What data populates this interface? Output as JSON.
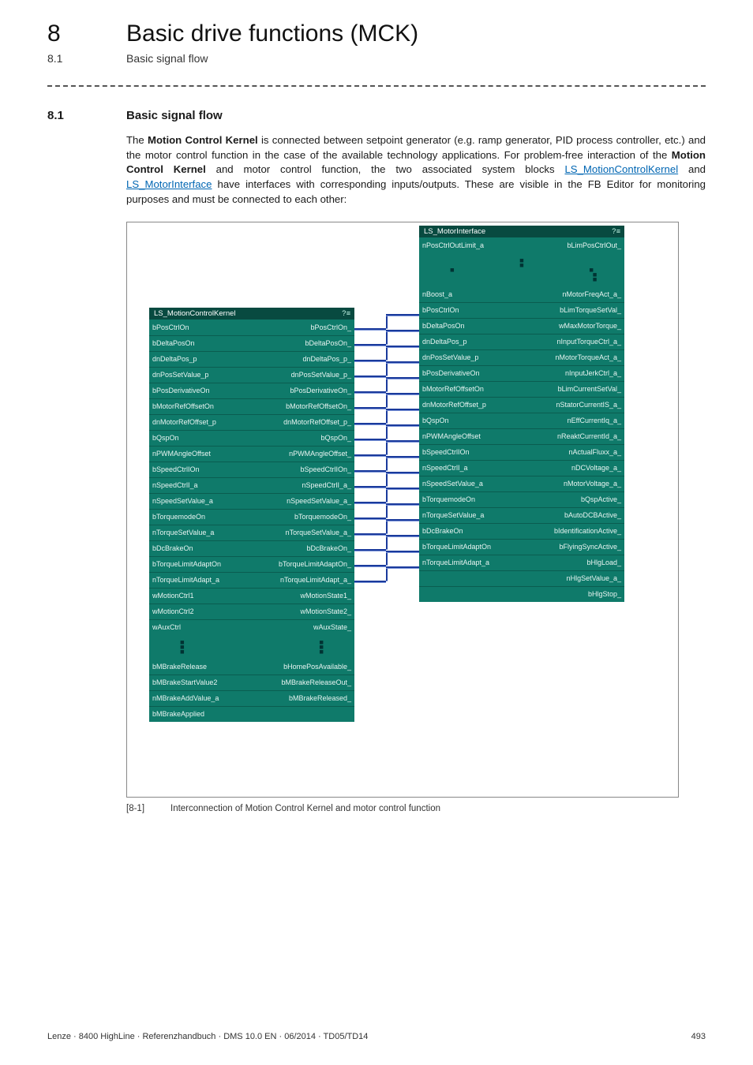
{
  "header": {
    "chapter_number": "8",
    "chapter_title": "Basic drive functions (MCK)",
    "sub_number": "8.1",
    "sub_title": "Basic signal flow"
  },
  "section": {
    "number": "8.1",
    "title": "Basic signal flow"
  },
  "paragraph": {
    "p1a": "The ",
    "p1b": "Motion Control Kernel",
    "p1c": " is connected between setpoint generator (e.g. ramp generator, PID process controller, etc.) and the motor control function in the case of the available technology applications. For problem-free interaction of the ",
    "p1d": "Motion Control Kernel",
    "p1e": " and motor control function, the two associated system blocks ",
    "link1": "LS_MotionControlKernel",
    "p1f": " and ",
    "link2": "LS_MotorInterface",
    "p1g": " have interfaces with corresponding inputs/outputs. These are visible in the FB Editor for monitoring purposes and must be connected to each other:"
  },
  "diagram": {
    "kernel": {
      "title": "LS_MotionControlKernel",
      "rows": [
        {
          "l": "bPosCtrlOn",
          "r": "bPosCtrlOn_"
        },
        {
          "l": "bDeltaPosOn",
          "r": "bDeltaPosOn_"
        },
        {
          "l": "dnDeltaPos_p",
          "r": "dnDeltaPos_p_"
        },
        {
          "l": "dnPosSetValue_p",
          "r": "dnPosSetValue_p_"
        },
        {
          "l": "bPosDerivativeOn",
          "r": "bPosDerivativeOn_"
        },
        {
          "l": "bMotorRefOffsetOn",
          "r": "bMotorRefOffsetOn_"
        },
        {
          "l": "dnMotorRefOffset_p",
          "r": "dnMotorRefOffset_p_"
        },
        {
          "l": "bQspOn",
          "r": "bQspOn_"
        },
        {
          "l": "nPWMAngleOffset",
          "r": "nPWMAngleOffset_"
        },
        {
          "l": "bSpeedCtrlIOn",
          "r": "bSpeedCtrlIOn_"
        },
        {
          "l": "nSpeedCtrlI_a",
          "r": "nSpeedCtrlI_a_"
        },
        {
          "l": "nSpeedSetValue_a",
          "r": "nSpeedSetValue_a_"
        },
        {
          "l": "bTorquemodeOn",
          "r": "bTorquemodeOn_"
        },
        {
          "l": "nTorqueSetValue_a",
          "r": "nTorqueSetValue_a_"
        },
        {
          "l": "bDcBrakeOn",
          "r": "bDcBrakeOn_"
        },
        {
          "l": "bTorqueLimitAdaptOn",
          "r": "bTorqueLimitAdaptOn_"
        },
        {
          "l": "nTorqueLimitAdapt_a",
          "r": "nTorqueLimitAdapt_a_"
        },
        {
          "l": "wMotionCtrl1",
          "r": "wMotionState1_"
        },
        {
          "l": "wMotionCtrl2",
          "r": "wMotionState2_"
        },
        {
          "l": "wAuxCtrl",
          "r": "wAuxState_"
        }
      ],
      "tail": [
        {
          "l": "bMBrakeRelease",
          "r": "bHomePosAvailable_"
        },
        {
          "l": "bMBrakeStartValue2",
          "r": "bMBrakeReleaseOut_"
        },
        {
          "l": "nMBrakeAddValue_a",
          "r": "bMBrakeReleased_"
        },
        {
          "l": "bMBrakeApplied",
          "r": ""
        }
      ]
    },
    "motor": {
      "title": "LS_MotorInterface",
      "head": [
        {
          "l": "nPosCtrlOutLimit_a",
          "r": "bLimPosCtrlOut_"
        }
      ],
      "rows": [
        {
          "l": "nBoost_a",
          "r": "nMotorFreqAct_a_"
        },
        {
          "l": "bPosCtrlOn",
          "r": "bLimTorqueSetVal_"
        },
        {
          "l": "bDeltaPosOn",
          "r": "wMaxMotorTorque_"
        },
        {
          "l": "dnDeltaPos_p",
          "r": "nInputTorqueCtrl_a_"
        },
        {
          "l": "dnPosSetValue_p",
          "r": "nMotorTorqueAct_a_"
        },
        {
          "l": "bPosDerivativeOn",
          "r": "nInputJerkCtrl_a_"
        },
        {
          "l": "bMotorRefOffsetOn",
          "r": "bLimCurrentSetVal_"
        },
        {
          "l": "dnMotorRefOffset_p",
          "r": "nStatorCurrentIS_a_"
        },
        {
          "l": "bQspOn",
          "r": "nEffCurrentIq_a_"
        },
        {
          "l": "nPWMAngleOffset",
          "r": "nReaktCurrentId_a_"
        },
        {
          "l": "bSpeedCtrlIOn",
          "r": "nActualFluxx_a_"
        },
        {
          "l": "nSpeedCtrlI_a",
          "r": "nDCVoltage_a_"
        },
        {
          "l": "nSpeedSetValue_a",
          "r": "nMotorVoltage_a_"
        },
        {
          "l": "bTorquemodeOn",
          "r": "bQspActive_"
        },
        {
          "l": "nTorqueSetValue_a",
          "r": "bAutoDCBActive_"
        },
        {
          "l": "bDcBrakeOn",
          "r": "bIdentificationActive_"
        },
        {
          "l": "bTorqueLimitAdaptOn",
          "r": "bFlyingSyncActive_"
        },
        {
          "l": "nTorqueLimitAdapt_a",
          "r": "bHlgLoad_"
        },
        {
          "l": "",
          "r": "nHlgSetValue_a_"
        },
        {
          "l": "",
          "r": "bHlgStop_"
        }
      ]
    }
  },
  "caption": {
    "tag": "[8-1]",
    "text": "Interconnection of Motion Control Kernel and motor control function"
  },
  "footer": {
    "left": "Lenze · 8400 HighLine · Referenzhandbuch · DMS 10.0 EN · 06/2014 · TD05/TD14",
    "right": "493"
  }
}
